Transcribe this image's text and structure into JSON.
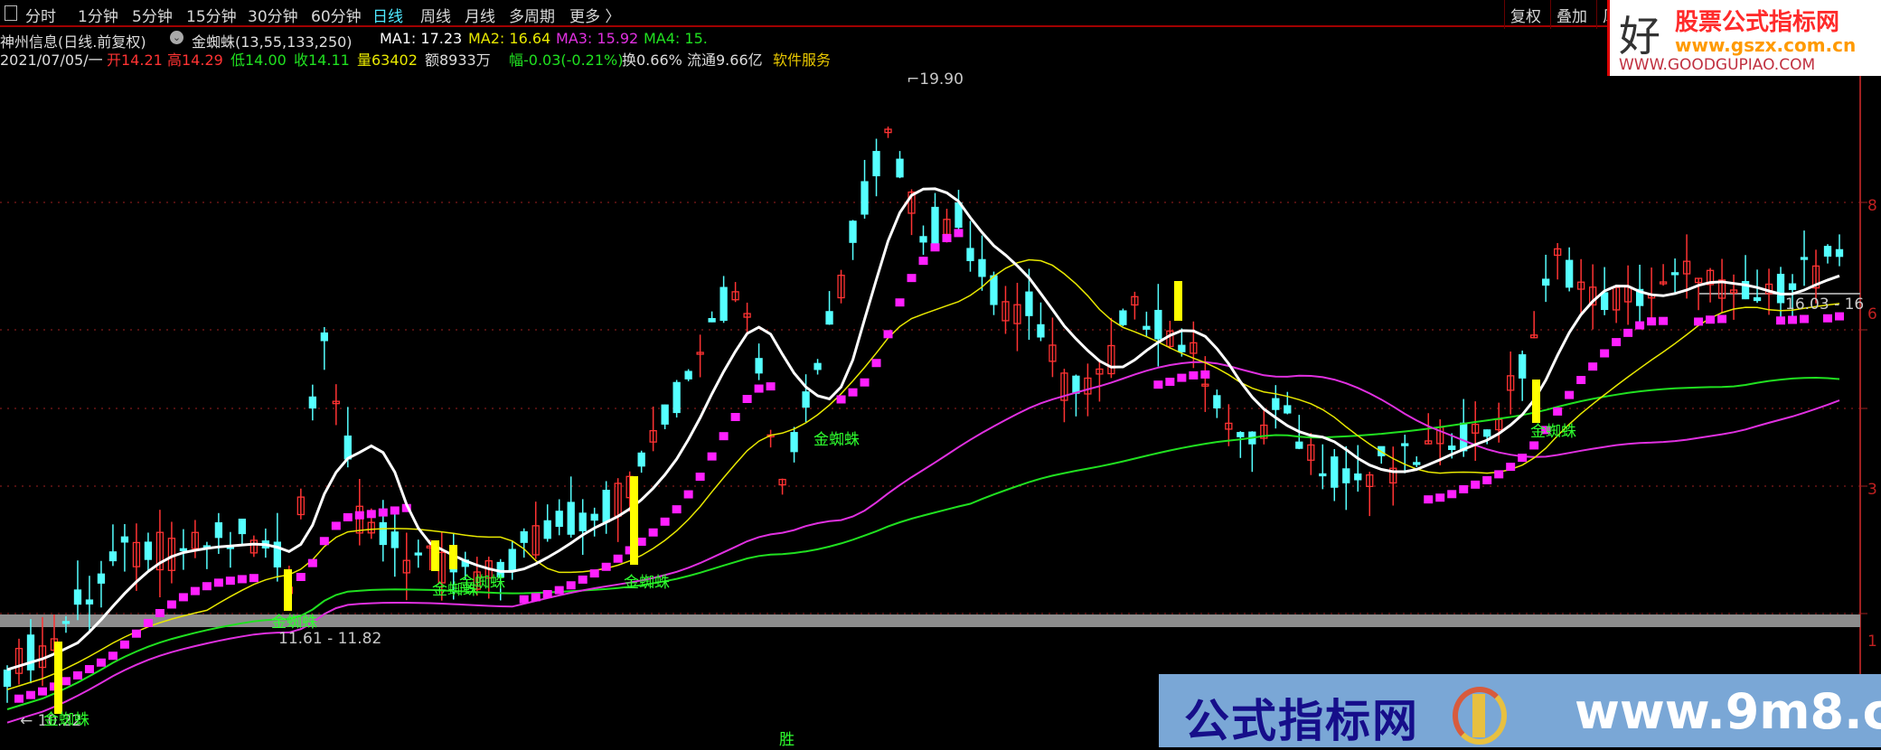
{
  "toolbar": {
    "items": [
      "分时",
      "1分钟",
      "5分钟",
      "15分钟",
      "30分钟",
      "60分钟",
      "日线",
      "周线",
      "月线",
      "多周期",
      "更多 〉"
    ],
    "active": "日线",
    "right": [
      "复权",
      "叠加",
      "风"
    ]
  },
  "info": {
    "title": "神州信息(日线.前复权)",
    "indicator": "金蜘蛛(13,55,133,250)",
    "ma1": "MA1: 17.23",
    "ma2": "MA2: 16.64",
    "ma3": "MA3: 15.92",
    "ma4": "MA4: 15.",
    "date": "2021/07/05/一",
    "open": "开14.21",
    "high": "高14.29",
    "low": "低14.00",
    "close": "收14.11",
    "volume": "量63402",
    "amount": "额8933万",
    "change": "幅-0.03(-0.21%)",
    "turnover": "换0.66%",
    "float": "流通9.66亿",
    "sector": "软件服务"
  },
  "colors": {
    "up": "#ff3333",
    "down": "#55ffff",
    "ma1": "#ffffff",
    "ma2": "#e8e800",
    "ma3": "#e030e0",
    "ma4": "#20e020",
    "band": "#ff20ff",
    "signal": "#ffff00",
    "accent": "#4fe8ff",
    "grid": "#a02020"
  },
  "annotations": {
    "high": "19.90",
    "low_range": "11.61 - 11.82",
    "start": "10.22",
    "right_range": "16.03 - 16",
    "signal_label": "金蜘蛛",
    "bottom_mark": "胜"
  },
  "axis_labels": [
    "8",
    "6",
    "3",
    "1"
  ],
  "logo": {
    "hao": "好",
    "title": "股票公式指标网",
    "url": "www.gszx.com.cn",
    "url2": "WWW.GOODGUPIAO.COM"
  },
  "watermark": {
    "title": "公式指标网",
    "url": "www.9m8.cn"
  },
  "chart_data": {
    "type": "candlestick",
    "ma_periods": [
      13,
      55,
      133,
      250
    ],
    "price_range": [
      10.22,
      19.9
    ],
    "closes": [
      10.97,
      11.3,
      11.9,
      12.6,
      12.8,
      12.8,
      12.9,
      12.9,
      12.4,
      16.2,
      13.2,
      12.86,
      12.6,
      12.4,
      12.4,
      13.0,
      13.2,
      13.4,
      14.1,
      15.0,
      16.4,
      16.6,
      13.8,
      15.6,
      17.6,
      19.1,
      17.6,
      17.7,
      16.7,
      16.4,
      15.3,
      15.4,
      16.4,
      16.1,
      15.5,
      14.3,
      14.8,
      14.3,
      13.8,
      14.0,
      14.2,
      14.5,
      14.6,
      15.5,
      17.2,
      16.6,
      16.6,
      16.7,
      17.1,
      16.5,
      16.6,
      17.1,
      17.0
    ]
  }
}
